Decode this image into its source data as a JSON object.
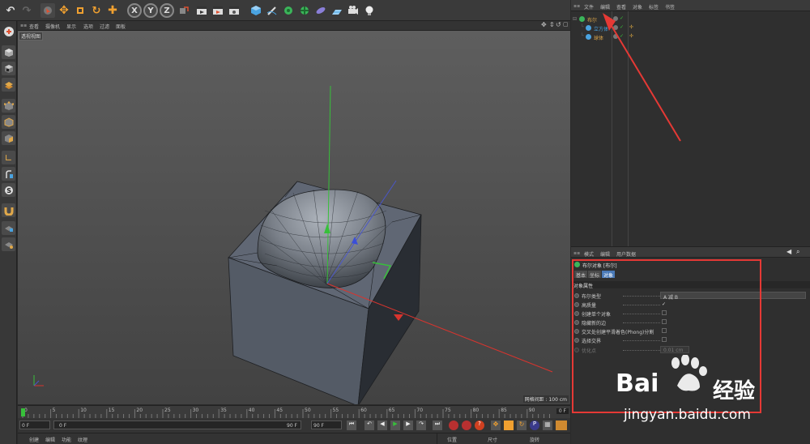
{
  "viewport_menu": [
    "查看",
    "摄像机",
    "显示",
    "选项",
    "过滤",
    "面板"
  ],
  "viewport_label": "透视视图",
  "grid_spacing": "网格间距 : 100 cm",
  "timeline": {
    "ticks": [
      "0",
      "5",
      "10",
      "15",
      "20",
      "25",
      "30",
      "35",
      "40",
      "45",
      "50",
      "55",
      "60",
      "65",
      "70",
      "75",
      "80",
      "85",
      "90"
    ],
    "current_frame": "0 F",
    "start_frame": "0 F",
    "range_start": "0 F",
    "range_end": "90 F",
    "end_frame": "90 F",
    "end_frame2": "90 F"
  },
  "bottom_menu": [
    "创建",
    "编辑",
    "功能",
    "纹理"
  ],
  "coord_labels": [
    "位置",
    "尺寸",
    "旋转"
  ],
  "object_menu": [
    "文件",
    "编辑",
    "查看",
    "对象",
    "标签",
    "书签"
  ],
  "objects": [
    {
      "name": "布尔",
      "color": "#e0a84a"
    },
    {
      "name": "立方体",
      "color": "#4aa3e0"
    },
    {
      "name": "球体",
      "color": "#e0a84a"
    }
  ],
  "attr_menu": [
    "模式",
    "编辑",
    "用户数据"
  ],
  "attr_title": "布尔对象 [布尔]",
  "attr_tabs": [
    "基本",
    "坐标",
    "对象"
  ],
  "attr_section": "对象属性",
  "properties": [
    {
      "name": "布尔类型",
      "value": "A 减 B"
    },
    {
      "name": "高质量",
      "value": "✓"
    },
    {
      "name": "创建单个对象",
      "value": ""
    },
    {
      "name": "隐藏新的边",
      "value": ""
    },
    {
      "name": "交叉处创建平滑着色(Phong)分割",
      "value": ""
    },
    {
      "name": "选择交界",
      "value": ""
    },
    {
      "name": "优化点",
      "value": "0.01 cm"
    }
  ],
  "watermark": {
    "brand": "Bai",
    "brand2": "经验",
    "url": "jingyan.baidu.com"
  },
  "colors": {
    "accent": "#e0a84a",
    "annotation": "#e53935"
  }
}
